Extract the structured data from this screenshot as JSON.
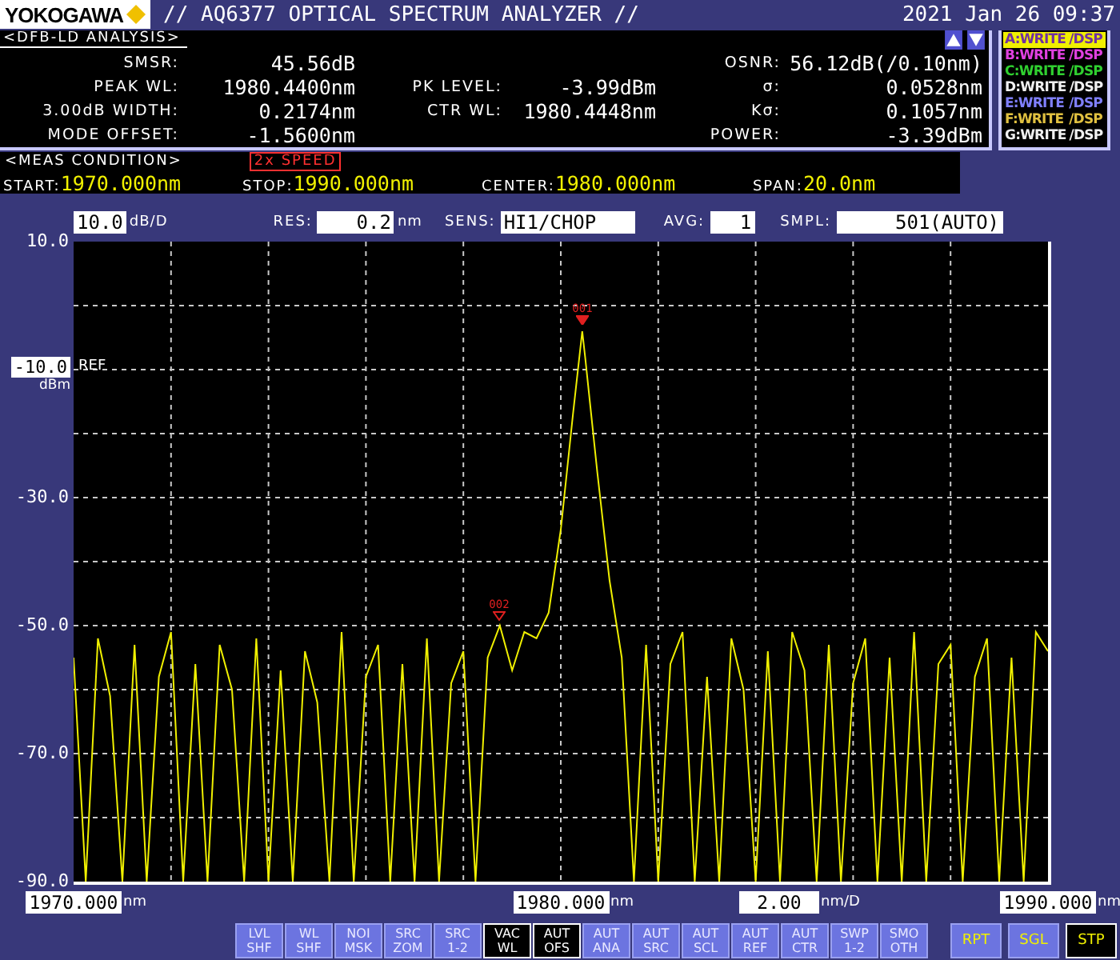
{
  "header": {
    "logo": "YOKOGAWA",
    "title": "// AQ6377 OPTICAL SPECTRUM ANALYZER //",
    "datetime": "2021 Jan 26 09:37"
  },
  "analysis": {
    "heading": "<DFB-LD ANALYSIS>",
    "rows": [
      {
        "left": {
          "label": "SMSR:",
          "value": "45.56dB"
        },
        "right": {
          "label": "OSNR:",
          "value": "56.12dB(/0.10nm)"
        }
      },
      {
        "left": {
          "label": "PEAK WL:",
          "value": "1980.4400nm"
        },
        "middle": {
          "label": "PK LEVEL:",
          "value": "-3.99dBm"
        },
        "right": {
          "label": "σ:",
          "value": "0.0528nm"
        }
      },
      {
        "left": {
          "label": "3.00dB WIDTH:",
          "value": "0.2174nm"
        },
        "middle": {
          "label": "CTR WL:",
          "value": "1980.4448nm"
        },
        "right": {
          "label": "Kσ:",
          "value": "0.1057nm"
        }
      },
      {
        "left": {
          "label": "MODE OFFSET:",
          "value": "-1.5600nm"
        },
        "right": {
          "label": "POWER:",
          "value": "-3.39dBm"
        }
      }
    ]
  },
  "traces": [
    {
      "label": "A:WRITE",
      "display": "/DSP",
      "color": "#f0f000",
      "selected": true
    },
    {
      "label": "B:WRITE",
      "display": "/DSP",
      "color": "#e040e0",
      "selected": false
    },
    {
      "label": "C:WRITE",
      "display": "/DSP",
      "color": "#30d030",
      "selected": false
    },
    {
      "label": "D:WRITE",
      "display": "/DSP",
      "color": "#f0f0f0",
      "selected": false
    },
    {
      "label": "E:WRITE",
      "display": "/DSP",
      "color": "#8080ff",
      "selected": false
    },
    {
      "label": "F:WRITE",
      "display": "/DSP",
      "color": "#e0c040",
      "selected": false
    },
    {
      "label": "G:WRITE",
      "display": "/DSP",
      "color": "#f0f0f0",
      "selected": false
    }
  ],
  "meas": {
    "heading": "<MEAS CONDITION>",
    "badge": "2x SPEED",
    "items": [
      {
        "label": "START:",
        "value": "1970.000nm"
      },
      {
        "label": "STOP:",
        "value": "1990.000nm"
      },
      {
        "label": "CENTER:",
        "value": "1980.000nm"
      },
      {
        "label": "SPAN:",
        "value": "20.0nm"
      }
    ]
  },
  "settings": [
    {
      "value": "10.0",
      "unit": "dB/D"
    },
    {
      "label": "RES:",
      "value": "0.2",
      "unit": "nm"
    },
    {
      "label": "SENS:",
      "value": "HI1/CHOP"
    },
    {
      "label": "AVG:",
      "value": "1"
    },
    {
      "label": "SMPL:",
      "value": "501(AUTO)"
    }
  ],
  "y_axis": {
    "ref": {
      "value": "-10.0",
      "unit": "dBm",
      "label": "REF"
    }
  },
  "spectrum": {
    "chart_data": {
      "type": "line",
      "xlim": [
        1970,
        1990
      ],
      "ylim": [
        -90,
        10
      ],
      "grid": true,
      "xticks": [
        {
          "value": 1970,
          "label": "1970.000"
        },
        {
          "value": 1980,
          "label": "1980.000"
        },
        {
          "value": 1990,
          "label": "1990.000"
        }
      ],
      "yticks": [
        {
          "value": 10,
          "label": "10.0"
        },
        {
          "value": -30,
          "label": "-30.0"
        },
        {
          "value": -50,
          "label": "-50.0"
        },
        {
          "value": -70,
          "label": "-70.0"
        },
        {
          "value": -90,
          "label": "-90.0"
        }
      ],
      "x": [
        1970,
        1970.25,
        1970.5,
        1970.75,
        1971,
        1971.25,
        1971.5,
        1971.75,
        1972,
        1972.25,
        1972.5,
        1972.75,
        1973,
        1973.25,
        1973.5,
        1973.75,
        1974,
        1974.25,
        1974.5,
        1974.75,
        1975,
        1975.25,
        1975.5,
        1975.75,
        1976,
        1976.25,
        1976.5,
        1976.75,
        1977,
        1977.25,
        1977.5,
        1977.75,
        1978,
        1978.25,
        1978.5,
        1978.75,
        1979,
        1979.25,
        1979.5,
        1979.75,
        1980,
        1980.25,
        1980.44,
        1980.5,
        1980.75,
        1981,
        1981.25,
        1981.5,
        1981.75,
        1982,
        1982.25,
        1982.5,
        1982.75,
        1983,
        1983.25,
        1983.5,
        1983.75,
        1984,
        1984.25,
        1984.5,
        1984.75,
        1985,
        1985.25,
        1985.5,
        1985.75,
        1986,
        1986.25,
        1986.5,
        1986.75,
        1987,
        1987.25,
        1987.5,
        1987.75,
        1988,
        1988.25,
        1988.5,
        1988.75,
        1989,
        1989.25,
        1989.5,
        1989.75,
        1990
      ],
      "series": [
        {
          "color": "#f0f000",
          "values": [
            -55,
            -90,
            -52,
            -61,
            -90,
            -53,
            -90,
            -58,
            -51,
            -90,
            -56,
            -90,
            -53,
            -60,
            -90,
            -52,
            -90,
            -57,
            -90,
            -54,
            -62,
            -90,
            -51,
            -90,
            -58,
            -53,
            -90,
            -56,
            -90,
            -52,
            -90,
            -59,
            -54,
            -90,
            -55,
            -50,
            -57,
            -51,
            -52,
            -48,
            -35,
            -17,
            -4,
            -8,
            -26,
            -43,
            -55,
            -90,
            -53,
            -90,
            -56,
            -51,
            -90,
            -58,
            -90,
            -52,
            -60,
            -90,
            -54,
            -90,
            -51,
            -57,
            -90,
            -53,
            -90,
            -59,
            -52,
            -90,
            -55,
            -90,
            -51,
            -90,
            -56,
            -53,
            -90,
            -58,
            -52,
            -90,
            -55,
            -90,
            -51,
            -54
          ]
        }
      ]
    }
  },
  "markers": [
    {
      "label": "001"
    },
    {
      "label": "002"
    }
  ],
  "x_axis": [
    {
      "kind": "tick",
      "unit": "nm"
    },
    {
      "kind": "tick",
      "unit": "nm"
    },
    {
      "kind": "scale",
      "value": "2.00",
      "unit": "nm/D"
    },
    {
      "kind": "tick",
      "unit": "nm"
    }
  ],
  "softkeys": [
    {
      "kind": "func",
      "lines": [
        "LVL",
        "SHF"
      ],
      "selected": false
    },
    {
      "kind": "func",
      "lines": [
        "WL",
        "SHF"
      ],
      "selected": false
    },
    {
      "kind": "func",
      "lines": [
        "NOI",
        "MSK"
      ],
      "selected": false
    },
    {
      "kind": "func",
      "lines": [
        "SRC",
        "ZOM"
      ],
      "selected": false
    },
    {
      "kind": "func",
      "lines": [
        "SRC",
        "1-2"
      ],
      "selected": false
    },
    {
      "kind": "func",
      "lines": [
        "VAC",
        "WL"
      ],
      "selected": true
    },
    {
      "kind": "func",
      "lines": [
        "AUT",
        "OFS"
      ],
      "selected": true
    },
    {
      "kind": "func",
      "lines": [
        "AUT",
        "ANA"
      ],
      "selected": false
    },
    {
      "kind": "func",
      "lines": [
        "AUT",
        "SRC"
      ],
      "selected": false
    },
    {
      "kind": "func",
      "lines": [
        "AUT",
        "SCL"
      ],
      "selected": false
    },
    {
      "kind": "func",
      "lines": [
        "AUT",
        "REF"
      ],
      "selected": false
    },
    {
      "kind": "func",
      "lines": [
        "AUT",
        "CTR"
      ],
      "selected": false
    },
    {
      "kind": "func",
      "lines": [
        "SWP",
        "1-2"
      ],
      "selected": false
    },
    {
      "kind": "func",
      "lines": [
        "SMO",
        "OTH"
      ],
      "selected": false
    },
    {
      "kind": "sweep",
      "lines": [
        "RPT"
      ],
      "selected": false
    },
    {
      "kind": "sweep",
      "lines": [
        "SGL"
      ],
      "selected": false
    },
    {
      "kind": "sweep",
      "lines": [
        "STP"
      ],
      "selected": true
    }
  ]
}
